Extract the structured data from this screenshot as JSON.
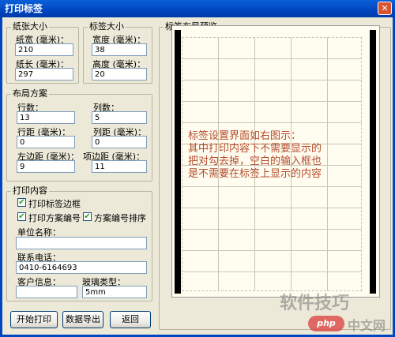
{
  "window": {
    "title": "打印标签",
    "close_glyph": "✕"
  },
  "paper_size": {
    "legend": "纸张大小",
    "width_label": "纸宽 (毫米)：",
    "width_value": "210",
    "length_label": "纸长 (毫米)：",
    "length_value": "297"
  },
  "label_size": {
    "legend": "标签大小",
    "width_label": "宽度 (毫米)：",
    "width_value": "38",
    "height_label": "高度 (毫米)：",
    "height_value": "20"
  },
  "layout": {
    "legend": "布局方案",
    "rows_label": "行数：",
    "rows_value": "13",
    "cols_label": "列数：",
    "cols_value": "5",
    "row_gap_label": "行距 (毫米)：",
    "row_gap_value": "0",
    "col_gap_label": "列距 (毫米)：",
    "col_gap_value": "0",
    "left_margin_label": "左边距 (毫米)：",
    "left_margin_value": "9",
    "top_margin_label": "项边距 (毫米)：",
    "top_margin_value": "11"
  },
  "print_content": {
    "legend": "打印内容",
    "border_checkbox_label": "打印标签边框",
    "scheme_number_checkbox_label": "打印方案编号",
    "scheme_sort_checkbox_label": "方案编号排序",
    "unit_name_label": "单位名称：",
    "unit_name_value": "",
    "phone_label": "联系电话：",
    "phone_value": "0410-6164693",
    "customer_info_label": "客户信息：",
    "customer_info_value": "",
    "glass_type_label": "玻璃类型：",
    "glass_type_value": "5mm"
  },
  "buttons": {
    "start_print": "开始打印",
    "export_data": "数据导出",
    "back": "返回"
  },
  "preview": {
    "legend": "标签布局预览",
    "note_lines": [
      "标签设置界面如右图示：",
      "其中打印内容下不需要显示的",
      "把对勾去掉，空白的输入框也",
      "是不需要在标签上显示的内容"
    ]
  },
  "watermark": {
    "line1": "软件技巧",
    "logo": "php",
    "line2": "中文网"
  },
  "colors": {
    "title_bar": "#0046c0",
    "dialog_bg": "#ece9d8",
    "preview_bg": "#fffdf0",
    "note_text": "#b54a2a",
    "check_mark": "#21a121"
  }
}
